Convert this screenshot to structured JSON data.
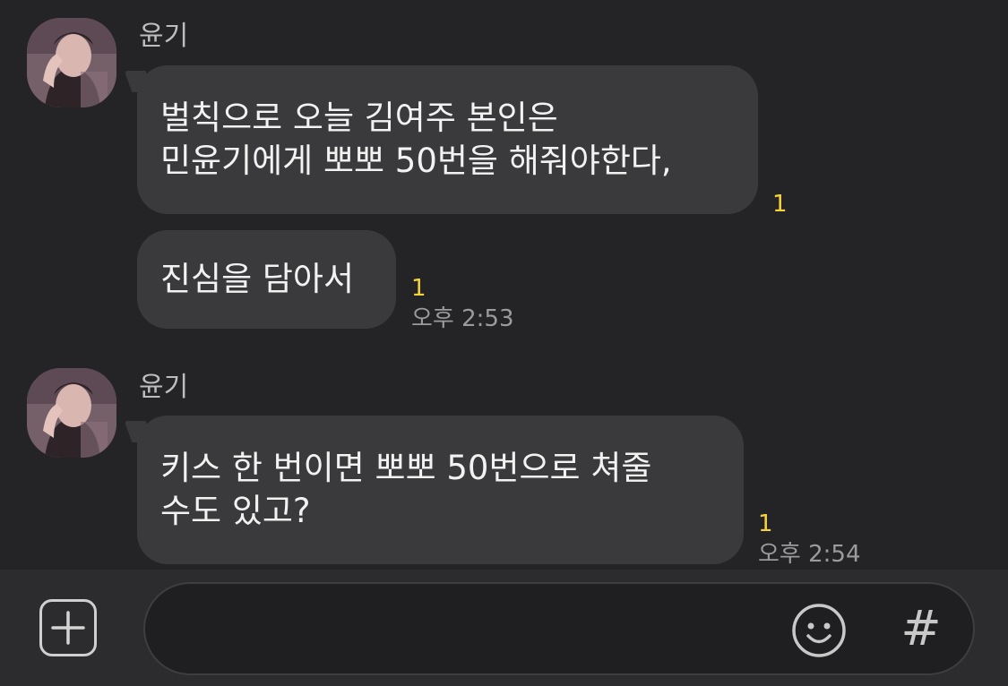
{
  "messages": [
    {
      "sender": "윤기",
      "bubbles": [
        {
          "lines": [
            "벌칙으로 오늘 김여주 본인은",
            "민윤기에게 뽀뽀 50번을 해줘야한다,"
          ],
          "unread": "1"
        },
        {
          "lines": [
            "진심을 담아서"
          ],
          "unread": "1",
          "time": "오후 2:53"
        }
      ]
    },
    {
      "sender": "윤기",
      "bubbles": [
        {
          "lines": [
            "키스 한 번이면 뽀뽀 50번으로 쳐줄",
            "수도 있고?"
          ],
          "unread": "1",
          "time": "오후 2:54"
        }
      ]
    }
  ],
  "input": {
    "placeholder": "",
    "value": "",
    "plus_icon": "plus-square-icon",
    "emoji_icon": "smiley-icon",
    "hash_label": "#"
  },
  "colors": {
    "background": "#242427",
    "bubble": "#3a3a3c",
    "unread": "#f5d33a",
    "input_bar": "#2c2c2e"
  }
}
